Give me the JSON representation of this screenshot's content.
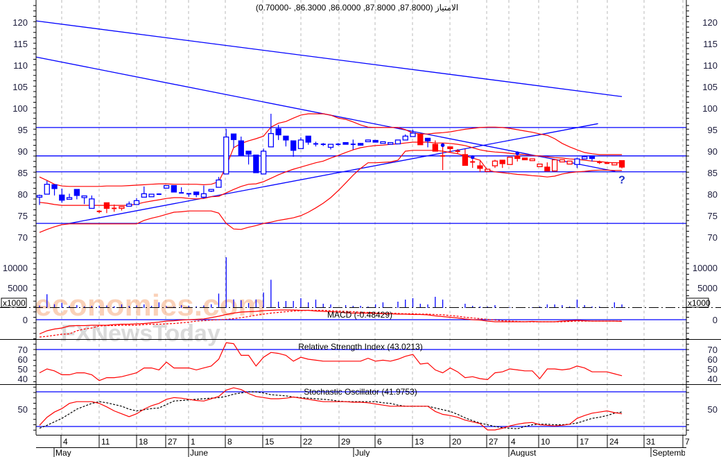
{
  "title": "الامتياز (87.8000, 87.8000, 86.0000, 86.3000, -0.70000)",
  "watermark": {
    "line1": "economies.com",
    "line2": "FXNewsToday"
  },
  "colors": {
    "up": "#0000ff",
    "down": "#ff0000",
    "band": "#ff0000",
    "trend": "#0000ff",
    "grid": "#b8b8b8",
    "axis": "#000000"
  },
  "chart_data": {
    "type": "candlestick",
    "price_axis": {
      "ticks": [
        120,
        115,
        110,
        105,
        100,
        95,
        90,
        85,
        80,
        75,
        70
      ],
      "range": [
        68.5,
        125
      ]
    },
    "volume_axis": {
      "ticks": [
        10000,
        5000
      ],
      "unit_label": "x1000"
    },
    "dates": {
      "day_labels": [
        "4",
        "11",
        "18",
        "27",
        "1",
        "8",
        "15",
        "22",
        "29",
        "6",
        "13",
        "20",
        "27",
        "4",
        "10",
        "17",
        "24",
        "31",
        "7"
      ],
      "month_labels": [
        "May",
        "June",
        "July",
        "August",
        "September"
      ]
    },
    "candles": [
      [
        79.3,
        79.9,
        77.5,
        79.7,
        "b"
      ],
      [
        80,
        83.1,
        80,
        82.3,
        "b"
      ],
      [
        82.2,
        82.3,
        79.7,
        81.3,
        "b"
      ],
      [
        79.8,
        81.3,
        78,
        78.6,
        "b"
      ],
      [
        78.8,
        80.1,
        78.8,
        79.2,
        "b"
      ],
      [
        81.1,
        81.1,
        78.8,
        79.7,
        "b"
      ],
      [
        79.2,
        79.6,
        77.7,
        79.6,
        "b"
      ],
      [
        76.7,
        79.7,
        76.7,
        78.9,
        "b"
      ],
      [
        76,
        76.3,
        75.6,
        75.9,
        "r"
      ],
      [
        78,
        78,
        75.6,
        76.7,
        "r"
      ],
      [
        76.7,
        77.6,
        75.9,
        76.7,
        "r"
      ],
      [
        76.7,
        77.1,
        76.2,
        77.1,
        "r"
      ],
      [
        77.2,
        78.3,
        77.2,
        77.7,
        "b"
      ],
      [
        77.6,
        79.1,
        77.6,
        78.5,
        "b"
      ],
      [
        79.3,
        81.8,
        79.3,
        80.1,
        "b"
      ],
      [
        79.4,
        80,
        79.4,
        80,
        "b"
      ],
      [
        80,
        80.2,
        79.8,
        80,
        "b"
      ],
      [
        81.4,
        82,
        81.4,
        82,
        "b"
      ],
      [
        82,
        82,
        80.5,
        80.5,
        "b"
      ],
      [
        80.3,
        81.6,
        80.2,
        80.2,
        "b"
      ],
      [
        80.1,
        80.1,
        79.4,
        79.9,
        "b"
      ],
      [
        80.5,
        80.5,
        79.3,
        79.9,
        "b"
      ],
      [
        79.3,
        82,
        79,
        80.1,
        "b"
      ],
      [
        80.7,
        81.1,
        80.5,
        81.1,
        "b"
      ],
      [
        81.6,
        84,
        81.6,
        83.3,
        "b"
      ],
      [
        84.7,
        95.2,
        84.7,
        93.3,
        "b"
      ],
      [
        94,
        94,
        90.8,
        92.7,
        "b"
      ],
      [
        92.4,
        93.4,
        89,
        89,
        "b"
      ],
      [
        90,
        90,
        86.9,
        89.3,
        "b"
      ],
      [
        89.1,
        89.1,
        85,
        85,
        "b"
      ],
      [
        84.7,
        90.6,
        84.7,
        90,
        "b"
      ],
      [
        91,
        98.7,
        91,
        94.1,
        "b"
      ],
      [
        95.2,
        96.1,
        92.6,
        93.8,
        "b"
      ],
      [
        93.5,
        93.5,
        91.1,
        92.6,
        "b"
      ],
      [
        92.4,
        92.4,
        88.7,
        90.2,
        "b"
      ],
      [
        90.6,
        93.2,
        90.6,
        92.6,
        "b"
      ],
      [
        93.5,
        93.5,
        91.5,
        92.1,
        "b"
      ],
      [
        91.7,
        92.2,
        91.1,
        91.7,
        "b"
      ],
      [
        91.6,
        91.9,
        91.2,
        91.6,
        "b"
      ],
      [
        90.9,
        91.6,
        90.4,
        91.6,
        "b"
      ],
      [
        91.6,
        91.9,
        91.3,
        91.6,
        "b"
      ],
      [
        92,
        92.1,
        91.6,
        91.6,
        "b"
      ],
      [
        91.6,
        92.7,
        90.4,
        91.5,
        "b"
      ],
      [
        91.8,
        91.9,
        91.3,
        91.4,
        "b"
      ],
      [
        92.2,
        92.7,
        92.2,
        92.6,
        "b"
      ],
      [
        92.5,
        92.6,
        92.1,
        92.1,
        "b"
      ],
      [
        91.8,
        92.2,
        91.8,
        92.2,
        "b"
      ],
      [
        91.6,
        92,
        91.6,
        92,
        "b"
      ],
      [
        91.7,
        92.6,
        91.7,
        92.6,
        "b"
      ],
      [
        92.6,
        93.9,
        92.6,
        93.5,
        "b"
      ],
      [
        93.4,
        95,
        93.4,
        94.2,
        "b"
      ],
      [
        94,
        94,
        91.5,
        91.5,
        "r"
      ],
      [
        93,
        93,
        90.9,
        92.4,
        "b"
      ],
      [
        91.6,
        92.5,
        90,
        90,
        "r"
      ],
      [
        88.9,
        91.6,
        85.6,
        88.9,
        "r"
      ],
      [
        91,
        91,
        89.7,
        90.6,
        "r"
      ],
      [
        90,
        90.5,
        89.5,
        90,
        "r"
      ],
      [
        89.2,
        90.5,
        86.7,
        86.7,
        "r"
      ],
      [
        87.5,
        88.1,
        86.1,
        87.5,
        "r"
      ],
      [
        86.6,
        87.7,
        85.2,
        86,
        "r"
      ],
      [
        85.3,
        85.8,
        85.3,
        85.8,
        "r"
      ],
      [
        86.6,
        88,
        86.1,
        87.7,
        "r"
      ],
      [
        87.9,
        87.9,
        86.1,
        87.1,
        "r"
      ],
      [
        86.9,
        88.6,
        86.9,
        88.6,
        "r"
      ],
      [
        88.9,
        89,
        87.6,
        88.3,
        "r"
      ],
      [
        88.4,
        88.4,
        88,
        88,
        "r"
      ],
      [
        87.8,
        88.2,
        87.8,
        88.2,
        "r"
      ],
      [
        86.4,
        87,
        86.4,
        87,
        "r"
      ],
      [
        86.3,
        87.4,
        85.4,
        85.4,
        "r"
      ],
      [
        85.4,
        88,
        85.4,
        88,
        "r"
      ],
      [
        87.5,
        88,
        87.5,
        88,
        "r"
      ],
      [
        87,
        87.7,
        87,
        87.7,
        "r"
      ],
      [
        86.9,
        88.5,
        86.1,
        88.2,
        "b"
      ],
      [
        88.2,
        89,
        88.2,
        88.7,
        "b"
      ],
      [
        88.9,
        88.9,
        87.6,
        88.3,
        "b"
      ],
      [
        87.4,
        87.8,
        87,
        87.4,
        "r"
      ],
      [
        87,
        87.4,
        87,
        87.2,
        "r"
      ],
      [
        86.8,
        87.3,
        86.8,
        87.3,
        "r"
      ],
      [
        87.8,
        87.8,
        86,
        86.3,
        "r"
      ]
    ],
    "bollinger": {
      "upper": [
        84,
        83.2,
        82.3,
        81.9,
        81.8,
        81.8,
        81.8,
        81.8,
        81.8,
        81.9,
        81.9,
        81.9,
        82,
        82.1,
        82.2,
        82.3,
        82.4,
        82.4,
        82.3,
        82.3,
        82.3,
        82.3,
        82.2,
        82.3,
        82.9,
        86.5,
        90.8,
        91.8,
        92.4,
        92.9,
        93.5,
        95.6,
        96.5,
        96.9,
        97.7,
        98.4,
        98.7,
        98.7,
        98.7,
        98.4,
        97.7,
        97.4,
        96.8,
        96.1,
        95.6,
        95.5,
        95.5,
        95.5,
        95.5,
        95,
        94.2,
        94,
        94,
        94.2,
        94.3,
        94.5,
        94.8,
        95.1,
        95.3,
        95.5,
        95.6,
        95.6,
        95.5,
        95.3,
        95,
        94.7,
        94.4,
        94,
        93.7,
        92.9,
        91.8,
        91,
        90.3,
        89.7,
        89.4,
        89.2,
        89.2,
        89.2,
        89.2
      ],
      "middle": [
        78.1,
        77.9,
        77.6,
        77.4,
        77.4,
        77.4,
        77.4,
        77.4,
        77.4,
        77.4,
        77.4,
        77.4,
        77.4,
        77.7,
        78.1,
        78.4,
        78.7,
        79,
        79.2,
        79.2,
        79,
        78.9,
        79,
        79.4,
        79.5,
        80.3,
        81.1,
        81.8,
        82.3,
        82.4,
        82.9,
        83.7,
        84.5,
        85.2,
        85.8,
        86.3,
        86.8,
        87.3,
        87.7,
        88.4,
        89,
        89.7,
        90.3,
        90.8,
        91.1,
        91.3,
        91.4,
        91.6,
        91.7,
        91.9,
        92.1,
        92.1,
        92.1,
        91.9,
        91.9,
        91.8,
        91.6,
        91.3,
        90.8,
        90.3,
        90,
        89.8,
        89.7,
        89.5,
        89.3,
        89.2,
        89,
        88.9,
        88.7,
        88.5,
        88.4,
        88.2,
        88.1,
        87.9,
        87.7,
        87.6,
        87.4,
        87.3,
        87.3
      ],
      "lower": [
        71.1,
        71.8,
        72.4,
        72.9,
        73.1,
        73.1,
        73.1,
        73.1,
        73.1,
        73.1,
        73.1,
        73.1,
        73.1,
        73.1,
        73.9,
        74.4,
        74.8,
        75.3,
        75.8,
        75.9,
        76.1,
        76.1,
        76.1,
        76.1,
        75.6,
        73.2,
        71.9,
        71.8,
        72.3,
        72.7,
        73.2,
        73.5,
        73.9,
        74.2,
        74.5,
        75,
        75.8,
        76.8,
        77.9,
        79.2,
        80.8,
        82.6,
        84.4,
        86,
        87.3,
        87.3,
        87.4,
        87.5,
        87.9,
        90,
        90.2,
        90.2,
        90.2,
        90.2,
        90,
        89.7,
        89.4,
        88.9,
        88.4,
        87.9,
        85.6,
        85.2,
        85,
        84.8,
        84.6,
        84.5,
        84.3,
        84.2,
        84,
        84.2,
        84.7,
        85,
        85.2,
        85.3,
        85.5,
        85.6,
        85.6,
        85.5,
        85.5
      ]
    },
    "trendlines": [
      {
        "from": [
          -0.46,
          120.3
        ],
        "to": [
          78,
          102.7
        ]
      },
      {
        "from": [
          -0.46,
          111.9
        ],
        "to": [
          77.1,
          85.3
        ]
      },
      {
        "from": [
          4,
          73.2
        ],
        "to": [
          74.8,
          96.4
        ]
      }
    ],
    "horizontal_levels": [
      95.5,
      88.9,
      85.2,
      73.2
    ],
    "markers": [
      {
        "index": 54,
        "price": 91.4
      },
      {
        "index": 58,
        "price": 88.6
      },
      {
        "index": 64,
        "price": 89.5
      }
    ],
    "question_marker": {
      "index": 78,
      "price": 83.3,
      "label": "?"
    },
    "volume": [
      600,
      3400,
      900,
      1260,
      500,
      700,
      400,
      500,
      500,
      600,
      400,
      860,
      500,
      600,
      860,
      500,
      1380,
      400,
      300,
      690,
      500,
      400,
      600,
      900,
      3560,
      12590,
      2120,
      1900,
      1200,
      2100,
      3840,
      7000,
      1550,
      1720,
      1720,
      2410,
      1380,
      2070,
      1030,
      860,
      170,
      700,
      520,
      520,
      350,
      880,
      1380,
      200,
      1550,
      2070,
      2410,
      1030,
      860,
      2760,
      2070,
      100,
      200,
      1030,
      520,
      350,
      350,
      700,
      100,
      170,
      170,
      170,
      170,
      350,
      860,
      860,
      700,
      350,
      2070,
      700,
      350,
      350,
      100,
      1380,
      860
    ],
    "macd": {
      "label": "MACD (-0.48429)",
      "ticks": [
        0
      ],
      "macd": [
        -4.1,
        -3.2,
        -2.7,
        -2.4,
        -1.8,
        -1.7,
        -1.7,
        -1.6,
        -1.6,
        -1.6,
        -1.4,
        -1.3,
        -1.3,
        -1.2,
        -1.1,
        -0.9,
        -0.7,
        -0.4,
        -0.3,
        -0.1,
        0,
        0.1,
        0.2,
        0.6,
        1.0,
        1.5,
        1.9,
        2.2,
        2.3,
        2.4,
        2.6,
        2.7,
        2.8,
        2.8,
        2.8,
        2.7,
        2.7,
        2.5,
        2.4,
        2.3,
        2.2,
        2.0,
        1.9,
        1.9,
        1.9,
        1.8,
        1.7,
        1.7,
        1.6,
        1.6,
        1.5,
        1.5,
        1.4,
        1.1,
        0.9,
        0.7,
        0.5,
        0.2,
        0,
        -0.1,
        -0.4,
        -0.6,
        -0.6,
        -0.6,
        -0.6,
        -0.6,
        -0.5,
        -0.6,
        -0.6,
        -0.6,
        -0.4,
        -0.3,
        -0.2,
        -0.3,
        -0.4,
        -0.4,
        -0.4,
        -0.4,
        -0.48
      ],
      "signal": [
        -5,
        -4.8,
        -4.5,
        -4.2,
        -4.1,
        -3.2,
        -2.7,
        -2.4,
        -1.8,
        -1.7,
        -1.7,
        -1.6,
        -1.6,
        -1.6,
        -1.4,
        -1.3,
        -1.3,
        -1.2,
        -1.1,
        -0.9,
        -0.7,
        -0.4,
        -0.3,
        -0.1,
        0,
        0.1,
        0.3,
        0.6,
        0.9,
        1.3,
        1.6,
        1.9,
        2.1,
        2.3,
        2.5,
        2.6,
        2.7,
        2.7,
        2.7,
        2.6,
        2.5,
        2.4,
        2.3,
        2.2,
        2.1,
        2.0,
        1.9,
        1.9,
        1.8,
        1.7,
        1.7,
        1.6,
        1.6,
        1.5,
        1.4,
        1.2,
        1.0,
        0.7,
        0.5,
        0.3,
        0.1,
        -0.1,
        -0.3,
        -0.4,
        -0.5,
        -0.6,
        -0.6,
        -0.6,
        -0.6,
        -0.6,
        -0.6,
        -0.5,
        -0.4,
        -0.4,
        -0.4,
        -0.4,
        -0.4,
        -0.4,
        -0.4
      ]
    },
    "rsi": {
      "label": "Relative Strength Index (43.0213)",
      "ticks": [
        70,
        60,
        50,
        40
      ],
      "level": 70,
      "values": [
        46,
        50,
        48,
        44,
        44,
        46,
        46,
        44,
        38,
        41,
        41,
        42,
        44,
        46,
        51,
        51,
        49,
        57,
        51,
        51,
        51,
        49,
        51,
        53,
        60,
        77,
        76,
        64,
        64,
        53,
        62,
        67,
        66,
        64,
        58,
        62,
        60,
        59,
        58,
        58,
        58,
        58,
        58,
        58,
        61,
        58,
        59,
        58,
        60,
        63,
        65,
        55,
        56,
        49,
        46,
        51,
        47,
        41,
        42,
        40,
        39,
        46,
        47,
        50,
        49,
        48,
        48,
        40,
        50,
        50,
        49,
        50,
        53,
        51,
        47,
        47,
        47,
        45,
        43
      ]
    },
    "stochastic": {
      "label": "Stochastic Oscillator (41.9753)",
      "ticks": [
        50
      ],
      "levels": [
        80,
        20
      ],
      "k": [
        22,
        36,
        45,
        51,
        60,
        63,
        63,
        63,
        60,
        54,
        47,
        42,
        37,
        42,
        50,
        56,
        60,
        67,
        70,
        69,
        67,
        65,
        64,
        68,
        72,
        83,
        87,
        84,
        77,
        72,
        70,
        68,
        68,
        69,
        71,
        69,
        67,
        65,
        63,
        63,
        63,
        63,
        62,
        62,
        61,
        59,
        57,
        55,
        55,
        55,
        55,
        55,
        55,
        46,
        41,
        39,
        36,
        31,
        28,
        25,
        14,
        14,
        17,
        21,
        24,
        26,
        27,
        23,
        22,
        21,
        22,
        24,
        34,
        39,
        43,
        45,
        47,
        44,
        42
      ],
      "d": [
        17,
        22,
        28,
        34,
        42,
        50,
        55,
        60,
        63,
        61,
        58,
        55,
        50,
        47,
        49,
        51,
        52,
        58,
        64,
        65,
        66,
        67,
        68,
        69,
        70,
        72,
        76,
        78,
        80,
        80,
        78,
        75,
        74,
        73,
        71,
        70,
        69,
        68,
        67,
        66,
        64,
        63,
        63,
        63,
        63,
        63,
        61,
        60,
        57,
        55,
        55,
        55,
        55,
        52,
        49,
        46,
        41,
        35,
        30,
        26,
        23,
        20,
        18,
        17,
        16,
        20,
        23,
        24,
        24,
        23,
        23,
        24,
        26,
        30,
        34,
        36,
        39,
        43,
        45
      ]
    }
  }
}
